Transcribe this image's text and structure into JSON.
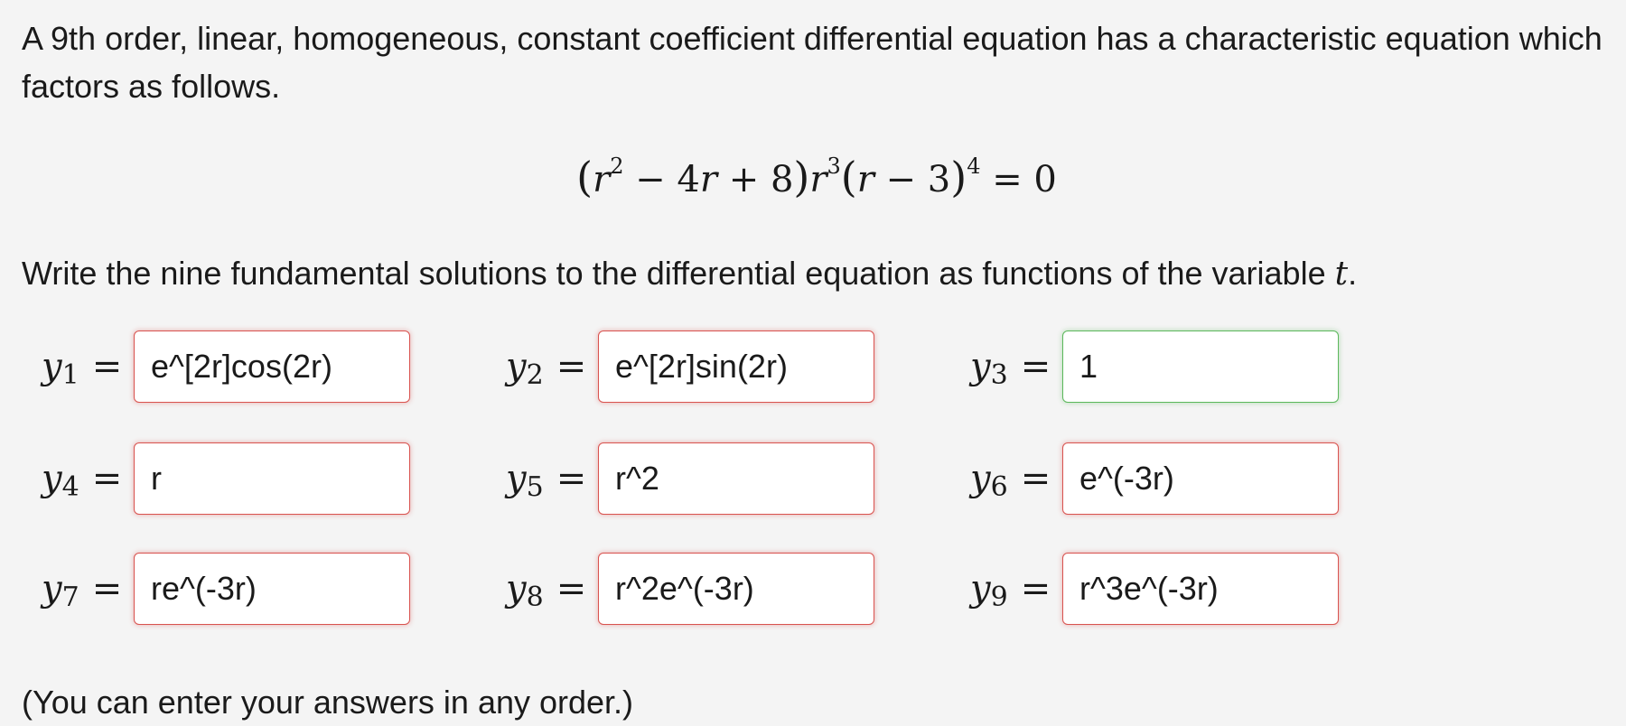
{
  "problem": {
    "intro": "A 9th order, linear, homogeneous, constant coefficient differential equation has a characteristic equation which factors as follows.",
    "instruction": "Write the nine fundamental solutions to the differential equation as functions of the variable",
    "variable": "t",
    "period": ".",
    "footer": "(You can enter your answers in any order.)"
  },
  "equation": {
    "open1": "(",
    "r": "r",
    "exp2": "2",
    "minus1": " − 4",
    "r2": "r",
    "plus": " + 8",
    "close1": ")",
    "r3": "r",
    "exp3": "3",
    "open2": "(",
    "r4": "r",
    "minus2": " − 3",
    "close2": ")",
    "exp4": "4",
    "rhs": " = 0"
  },
  "answers": [
    {
      "label_var": "y",
      "label_sub": "1",
      "eq": "=",
      "value": "e^[2r]cos(2r)",
      "status": "incorrect"
    },
    {
      "label_var": "y",
      "label_sub": "2",
      "eq": "=",
      "value": "e^[2r]sin(2r)",
      "status": "incorrect"
    },
    {
      "label_var": "y",
      "label_sub": "3",
      "eq": "=",
      "value": "1",
      "status": "correct"
    },
    {
      "label_var": "y",
      "label_sub": "4",
      "eq": "=",
      "value": "r",
      "status": "incorrect"
    },
    {
      "label_var": "y",
      "label_sub": "5",
      "eq": "=",
      "value": "r^2",
      "status": "incorrect"
    },
    {
      "label_var": "y",
      "label_sub": "6",
      "eq": "=",
      "value": "e^(-3r)",
      "status": "incorrect"
    },
    {
      "label_var": "y",
      "label_sub": "7",
      "eq": "=",
      "value": "re^(-3r)",
      "status": "incorrect"
    },
    {
      "label_var": "y",
      "label_sub": "8",
      "eq": "=",
      "value": "r^2e^(-3r)",
      "status": "incorrect"
    },
    {
      "label_var": "y",
      "label_sub": "9",
      "eq": "=",
      "value": "r^3e^(-3r)",
      "status": "incorrect"
    }
  ],
  "colors": {
    "incorrect": "#d9534f",
    "correct": "#5cb85c",
    "background": "#f4f4f4"
  }
}
